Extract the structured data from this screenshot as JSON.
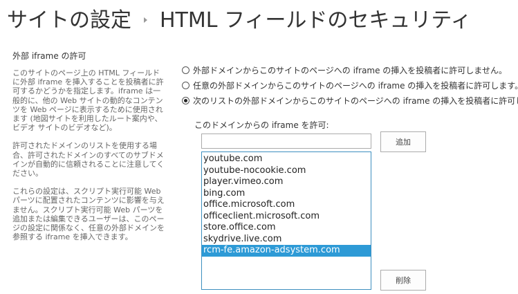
{
  "header": {
    "crumb": "サイトの設定",
    "page_title": "HTML フィールドのセキュリティ"
  },
  "section": {
    "heading": "外部 iframe の許可",
    "paragraphs": [
      "このサイトのページ上の HTML フィールドに外部 iframe を挿入することを投稿者に許可するかどうかを指定します。iframe は一般的に、他の Web サイトの動的なコンテンツを Web ページに表示するために使用されます (地図サイトを利用したルート案内や、ビデオ サイトのビデオなど)。",
      "許可されたドメインのリストを使用する場合、許可されたドメインのすべてのサブドメインが自動的に信頼されることに注意してください。",
      "これらの設定は、スクリプト実行可能 Web パーツに配置されたコンテンツに影響を与えません。スクリプト実行可能 Web パーツを追加または編集できるユーザーは、このページの設定に関係なく、任意の外部ドメインを参照する iframe を挿入できます。"
    ]
  },
  "options": [
    {
      "label": "外部ドメインからこのサイトのページへの iframe の挿入を投稿者に許可しません。",
      "checked": false
    },
    {
      "label": "任意の外部ドメインからこのサイトのページへの iframe の挿入を投稿者に許可します。",
      "checked": false
    },
    {
      "label": "次のリストの外部ドメインからこのサイトのページへの iframe の挿入を投稿者に許可します:",
      "checked": true
    }
  ],
  "allow_label": "このドメインからの iframe を許可:",
  "input": {
    "value": "",
    "placeholder": ""
  },
  "add_label": "追加",
  "remove_label": "削除",
  "domains": [
    "youtube.com",
    "youtube-nocookie.com",
    "player.vimeo.com",
    "bing.com",
    "office.microsoft.com",
    "officeclient.microsoft.com",
    "store.office.com",
    "skydrive.live.com",
    "rcm-fe.amazon-adsystem.com"
  ],
  "selected_domain": "rcm-fe.amazon-adsystem.com",
  "colors": {
    "selection": "#2d9ad6",
    "list_border": "#3d8fbf",
    "title_text": "#333333",
    "desc_text": "#666666"
  }
}
